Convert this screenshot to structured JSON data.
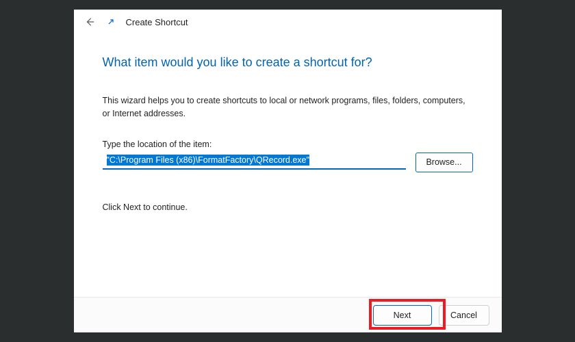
{
  "header": {
    "title": "Create Shortcut"
  },
  "main": {
    "heading": "What item would you like to create a shortcut for?",
    "description": "This wizard helps you to create shortcuts to local or network programs, files, folders, computers, or Internet addresses.",
    "fieldLabel": "Type the location of the item:",
    "pathValue": "\"C:\\Program Files (x86)\\FormatFactory\\QRecord.exe\"",
    "browseLabel": "Browse...",
    "continueText": "Click Next to continue."
  },
  "footer": {
    "nextLabel": "Next",
    "cancelLabel": "Cancel"
  }
}
